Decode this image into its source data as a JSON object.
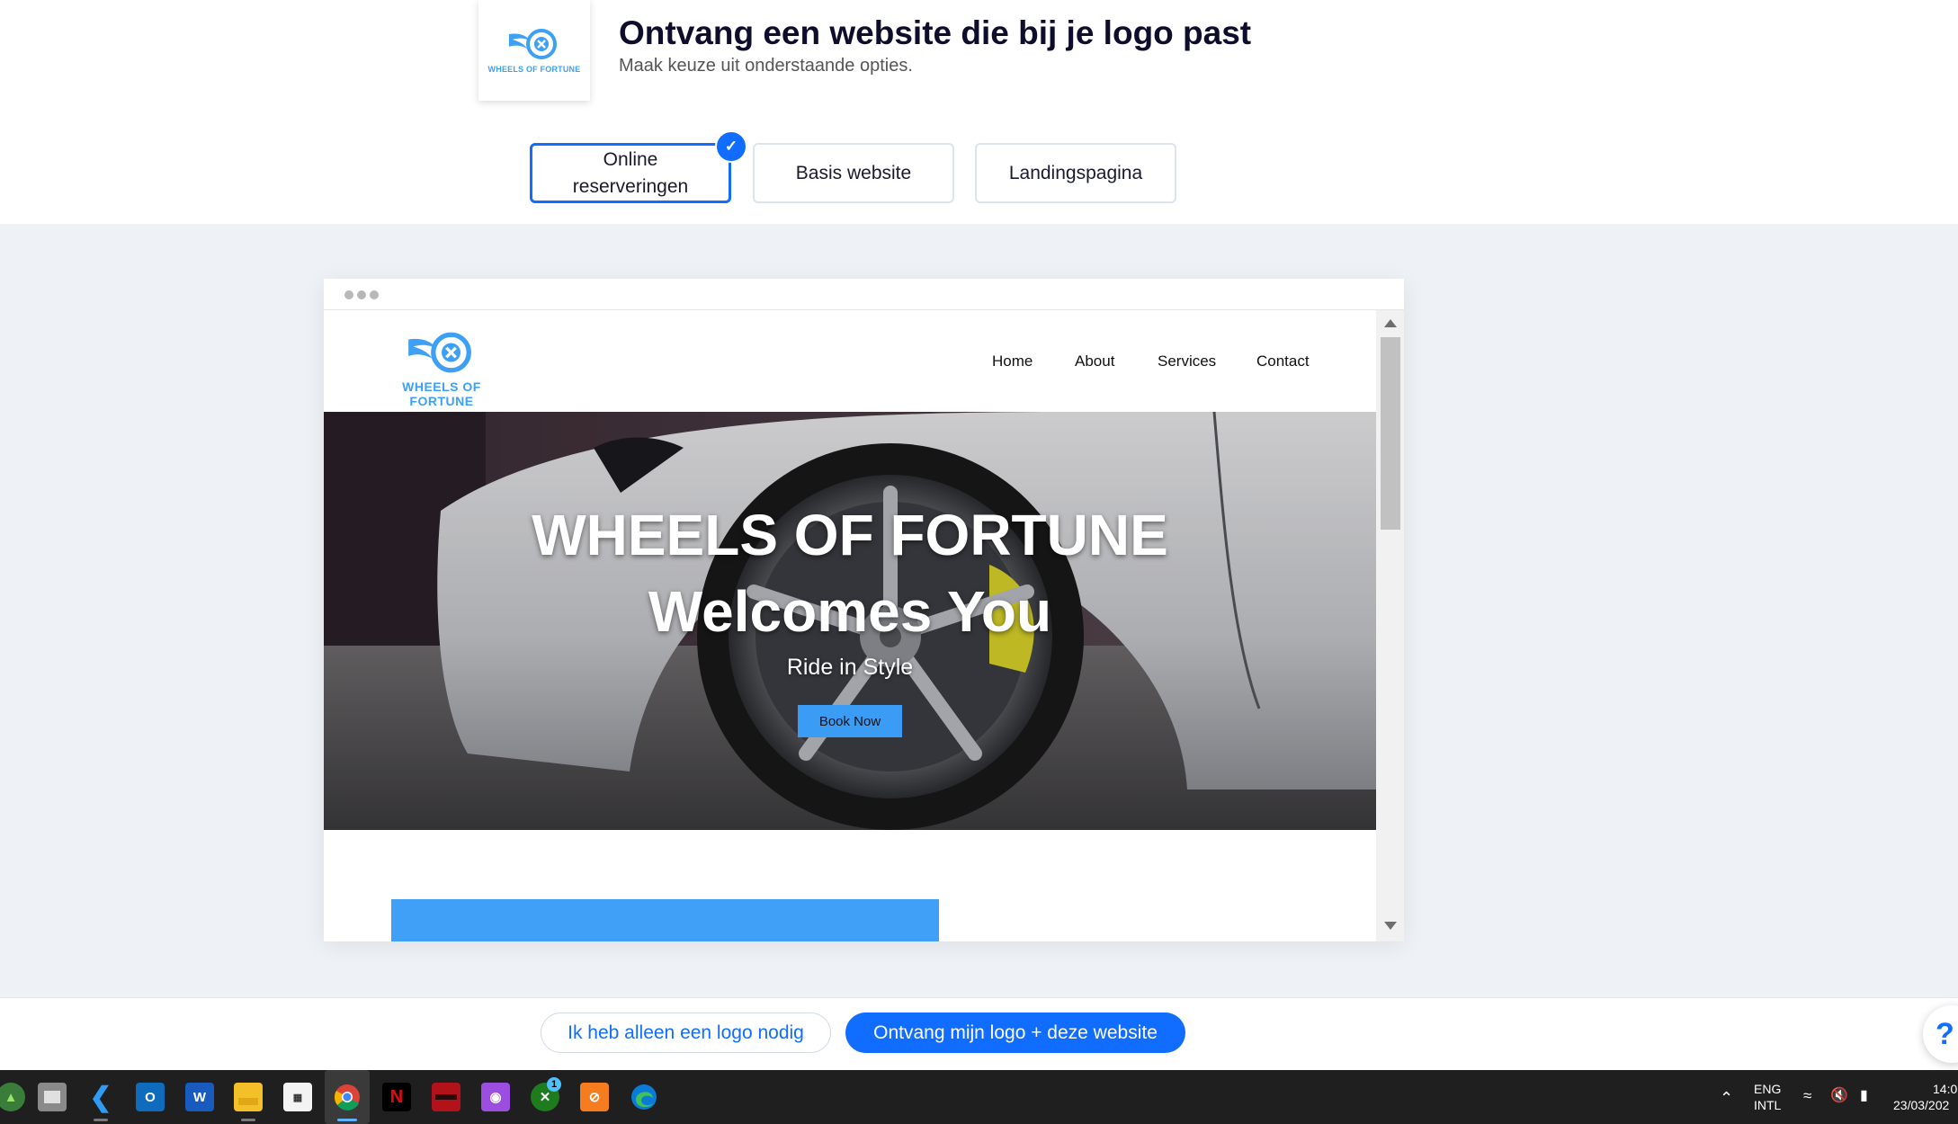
{
  "header": {
    "logo_thumb_text": "WHEELS OF FORTUNE",
    "title": "Ontvang een website die bij je logo past",
    "subtitle": "Maak keuze uit onderstaande opties."
  },
  "options": [
    {
      "label": "Online reserveringen",
      "selected": true
    },
    {
      "label": "Basis website",
      "selected": false
    },
    {
      "label": "Landingspagina",
      "selected": false
    }
  ],
  "preview": {
    "brand": "WHEELS OF FORTUNE",
    "nav": [
      "Home",
      "About",
      "Services",
      "Contact"
    ],
    "hero_line1": "WHEELS OF FORTUNE",
    "hero_line2": "Welcomes You",
    "hero_sub": "Ride in Style",
    "cta": "Book Now"
  },
  "actions": {
    "secondary": "Ik heb alleen een logo nodig",
    "primary": "Ontvang mijn logo + deze website",
    "help": "?"
  },
  "taskbar": {
    "icons": [
      "system-monitor",
      "file-explorer-alt",
      "vscode",
      "outlook",
      "word",
      "file-explorer",
      "microsoft-store",
      "chrome",
      "netflix",
      "app-red",
      "app-purple",
      "xbox",
      "xampp",
      "edge"
    ],
    "xbox_badge": "1",
    "lang_line1": "ENG",
    "lang_line2": "INTL",
    "time": "14:0",
    "date": "23/03/202"
  },
  "colors": {
    "accent": "#116dff",
    "brand_blue": "#3ea0f5",
    "preview_bg": "#eef1f5",
    "taskbar": "#1f1f1f"
  }
}
